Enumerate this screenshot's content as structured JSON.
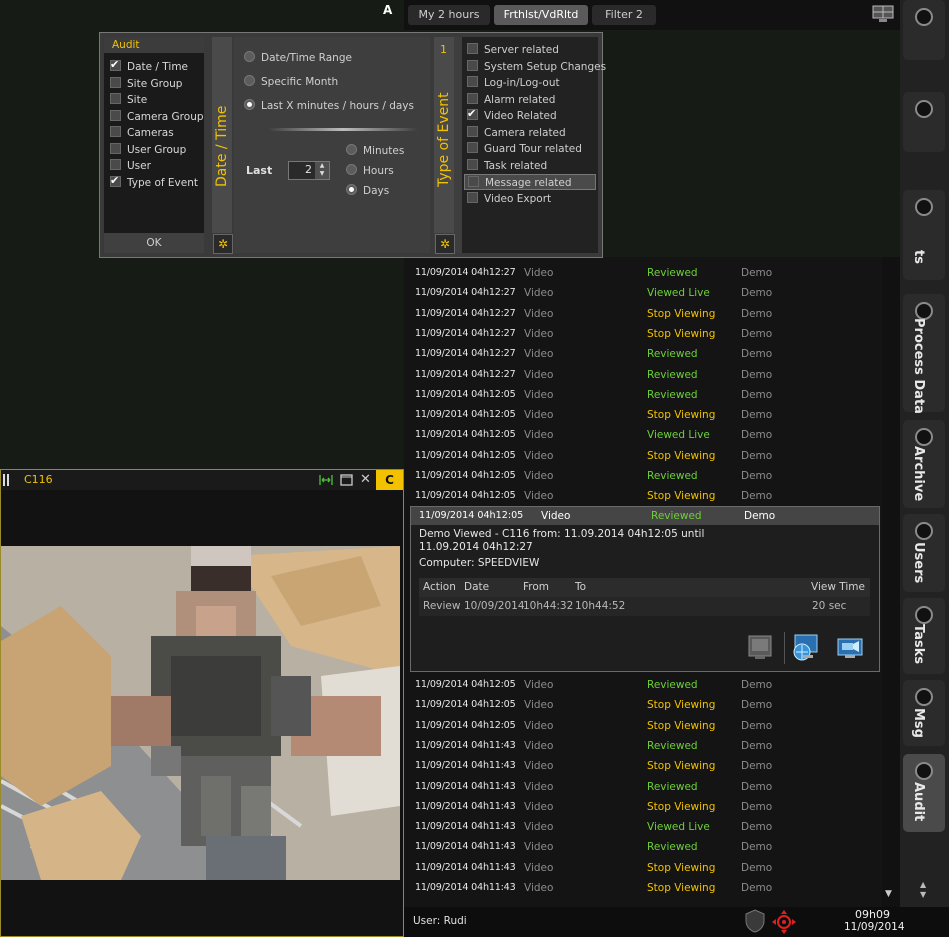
{
  "filter_tabs": [
    "My 2 hours",
    "Frthlst/VdRltd",
    "Filter 2"
  ],
  "top_label": "A",
  "popup": {
    "audit": {
      "title": "Audit",
      "items": [
        {
          "label": "Date / Time",
          "checked": true
        },
        {
          "label": "Site Group",
          "checked": false
        },
        {
          "label": "Site",
          "checked": false
        },
        {
          "label": "Camera Group",
          "checked": false
        },
        {
          "label": "Cameras",
          "checked": false
        },
        {
          "label": "User Group",
          "checked": false
        },
        {
          "label": "User",
          "checked": false
        },
        {
          "label": "Type of Event",
          "checked": true
        }
      ],
      "ok_label": "OK"
    },
    "date_time": {
      "title": "Date / Time",
      "modes": [
        {
          "label": "Date/Time Range",
          "selected": false
        },
        {
          "label": "Specific Month",
          "selected": false
        },
        {
          "label": "Last  X  minutes / hours / days",
          "selected": true
        }
      ],
      "last_label": "Last",
      "last_value": "2",
      "units": [
        {
          "label": "Minutes",
          "selected": false
        },
        {
          "label": "Hours",
          "selected": false
        },
        {
          "label": "Days",
          "selected": true
        }
      ]
    },
    "type_of_event": {
      "title": "Type of Event",
      "number": "1",
      "items": [
        {
          "label": "Server related",
          "checked": false
        },
        {
          "label": "System Setup Changes",
          "checked": false
        },
        {
          "label": "Log-in/Log-out",
          "checked": false
        },
        {
          "label": "Alarm related",
          "checked": false
        },
        {
          "label": "Video Related",
          "checked": true
        },
        {
          "label": "Camera related",
          "checked": false
        },
        {
          "label": "Guard Tour related",
          "checked": false
        },
        {
          "label": "Task related",
          "checked": false
        },
        {
          "label": "Message related",
          "checked": false,
          "highlighted": true
        },
        {
          "label": "Video Export",
          "checked": false
        }
      ]
    }
  },
  "rows_top": [
    {
      "date": "11/09/2014 04h12:27",
      "type": "Video",
      "action": "Reviewed",
      "color": "green",
      "user": "Demo"
    },
    {
      "date": "11/09/2014 04h12:27",
      "type": "Video",
      "action": "Viewed Live",
      "color": "green",
      "user": "Demo"
    },
    {
      "date": "11/09/2014 04h12:27",
      "type": "Video",
      "action": "Stop Viewing",
      "color": "yellow",
      "user": "Demo"
    },
    {
      "date": "11/09/2014 04h12:27",
      "type": "Video",
      "action": "Stop Viewing",
      "color": "yellow",
      "user": "Demo"
    },
    {
      "date": "11/09/2014 04h12:27",
      "type": "Video",
      "action": "Reviewed",
      "color": "green",
      "user": "Demo"
    },
    {
      "date": "11/09/2014 04h12:27",
      "type": "Video",
      "action": "Reviewed",
      "color": "green",
      "user": "Demo"
    },
    {
      "date": "11/09/2014 04h12:05",
      "type": "Video",
      "action": "Reviewed",
      "color": "green",
      "user": "Demo"
    },
    {
      "date": "11/09/2014 04h12:05",
      "type": "Video",
      "action": "Stop Viewing",
      "color": "yellow",
      "user": "Demo"
    },
    {
      "date": "11/09/2014 04h12:05",
      "type": "Video",
      "action": "Viewed Live",
      "color": "green",
      "user": "Demo"
    },
    {
      "date": "11/09/2014 04h12:05",
      "type": "Video",
      "action": "Stop Viewing",
      "color": "yellow",
      "user": "Demo"
    },
    {
      "date": "11/09/2014 04h12:05",
      "type": "Video",
      "action": "Reviewed",
      "color": "green",
      "user": "Demo"
    },
    {
      "date": "11/09/2014 04h12:05",
      "type": "Video",
      "action": "Stop Viewing",
      "color": "yellow",
      "user": "Demo"
    }
  ],
  "detail": {
    "date": "11/09/2014 04h12:05",
    "type": "Video",
    "action": "Reviewed",
    "user": "Demo",
    "description": "Demo Viewed  - C116 from: 11.09.2014 04h12:05 until 11.09.2014 04h12:27",
    "computer": "Computer: SPEEDVIEW",
    "sub_headers": {
      "action": "Action",
      "date": "Date",
      "from": "From",
      "to": "To",
      "view_time": "View Time"
    },
    "sub_row": {
      "action": "Review",
      "date": "10/09/2014",
      "from": "10h44:32",
      "to": "10h44:52",
      "view_time": "20 sec"
    },
    "icons": [
      "snapshot-icon",
      "globe-monitor-icon",
      "camera-monitor-icon"
    ]
  },
  "rows_bottom": [
    {
      "date": "11/09/2014 04h12:05",
      "type": "Video",
      "action": "Reviewed",
      "color": "green",
      "user": "Demo"
    },
    {
      "date": "11/09/2014 04h12:05",
      "type": "Video",
      "action": "Stop Viewing",
      "color": "yellow",
      "user": "Demo"
    },
    {
      "date": "11/09/2014 04h12:05",
      "type": "Video",
      "action": "Stop Viewing",
      "color": "yellow",
      "user": "Demo"
    },
    {
      "date": "11/09/2014 04h11:43",
      "type": "Video",
      "action": "Reviewed",
      "color": "green",
      "user": "Demo"
    },
    {
      "date": "11/09/2014 04h11:43",
      "type": "Video",
      "action": "Stop Viewing",
      "color": "yellow",
      "user": "Demo"
    },
    {
      "date": "11/09/2014 04h11:43",
      "type": "Video",
      "action": "Reviewed",
      "color": "green",
      "user": "Demo"
    },
    {
      "date": "11/09/2014 04h11:43",
      "type": "Video",
      "action": "Stop Viewing",
      "color": "yellow",
      "user": "Demo"
    },
    {
      "date": "11/09/2014 04h11:43",
      "type": "Video",
      "action": "Viewed Live",
      "color": "green",
      "user": "Demo"
    },
    {
      "date": "11/09/2014 04h11:43",
      "type": "Video",
      "action": "Reviewed",
      "color": "green",
      "user": "Demo"
    },
    {
      "date": "11/09/2014 04h11:43",
      "type": "Video",
      "action": "Stop Viewing",
      "color": "yellow",
      "user": "Demo"
    },
    {
      "date": "11/09/2014 04h11:43",
      "type": "Video",
      "action": "Stop Viewing",
      "color": "yellow",
      "user": "Demo"
    }
  ],
  "camera": {
    "title": "C116",
    "slot_letter": "C"
  },
  "status": {
    "user": "User: Rudi",
    "time": "09h09",
    "date": "11/09/2014"
  },
  "sidebar_tabs": [
    {
      "label": "ts",
      "active": false
    },
    {
      "label": "Process Data",
      "active": false
    },
    {
      "label": "Archive",
      "active": false
    },
    {
      "label": "Users",
      "active": false
    },
    {
      "label": "Tasks",
      "active": false
    },
    {
      "label": "Msg",
      "active": false
    },
    {
      "label": "Audit",
      "active": true
    }
  ],
  "colors": {
    "green": "#6ed03a",
    "yellow": "#f2c200",
    "accent": "#f2c200"
  }
}
